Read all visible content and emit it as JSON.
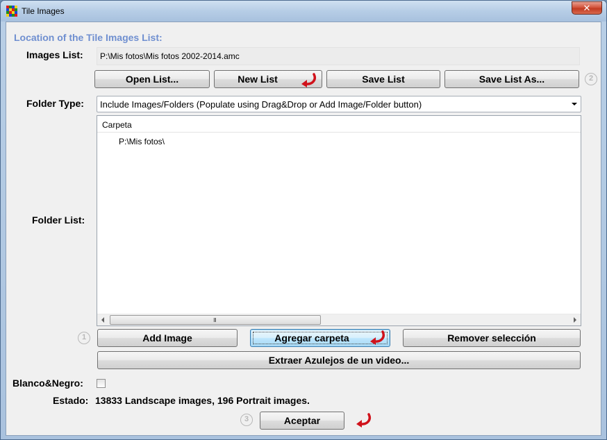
{
  "window": {
    "title": "Tile Images",
    "close_glyph": "✕"
  },
  "section_title": "Location of the Tile Images List:",
  "images_list": {
    "label": "Images List:",
    "value": "P:\\Mis fotos\\Mis fotos 2002-2014.amc"
  },
  "list_buttons": {
    "open": "Open List...",
    "new": "New List",
    "save": "Save List",
    "save_as": "Save List As..."
  },
  "step_badges": {
    "one": "1",
    "two": "2",
    "three": "3"
  },
  "folder_type": {
    "label": "Folder Type:",
    "selected": "Include Images/Folders (Populate using Drag&Drop or Add Image/Folder button)"
  },
  "folder_list": {
    "label": "Folder List:",
    "column_header": "Carpeta",
    "rows": [
      "P:\\Mis fotos\\"
    ],
    "scroll_grip": "III"
  },
  "folder_buttons": {
    "add_image": "Add Image",
    "add_folder": "Agregar carpeta",
    "remove": "Remover selección",
    "extract_video": "Extraer Azulejos de un video..."
  },
  "black_white": {
    "label": "Blanco&Negro:",
    "checked": false
  },
  "status": {
    "label": "Estado:",
    "text": "13833 Landscape images, 196 Portrait images."
  },
  "accept_button": "Aceptar",
  "colors": {
    "accent_title": "#6f8fd0",
    "arrow_red": "#d0121b"
  },
  "icons": {
    "app": "tile-grid-icon",
    "hint_arrow": "curved-red-arrow-icon"
  }
}
